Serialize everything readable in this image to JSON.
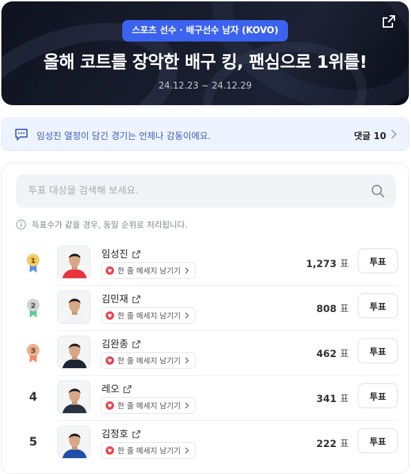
{
  "banner": {
    "badge": "스포츠 선수 · 배구선수 남자 (KOVO)",
    "title": "올해 코트를 장악한 배구 킹, 팬심으로 1위를!",
    "date_range": "24.12.23 ~ 24.12.29",
    "share_icon": "share-icon"
  },
  "comment_bar": {
    "message": "임성진 열정이 담긴 경기는 언제나 감동이에요.",
    "count_label": "댓글 10"
  },
  "search": {
    "placeholder": "투표 대상을 검색해 보세요."
  },
  "notice": "득표수가 같을 경우, 동일 순위로 처리됩니다.",
  "ranking": [
    {
      "rank": "1",
      "medal": "gold",
      "name": "임성진",
      "message_label": "한 줄 메세지 남기기",
      "votes": "1,273",
      "unit": "표",
      "vote_label": "투표",
      "jersey": "#e8343e"
    },
    {
      "rank": "2",
      "medal": "silver",
      "name": "김민재",
      "message_label": "한 줄 메세지 남기기",
      "votes": "808",
      "unit": "표",
      "vote_label": "투표",
      "jersey": "#f2f2f5"
    },
    {
      "rank": "3",
      "medal": "bronze",
      "name": "김완종",
      "message_label": "한 줄 메세지 남기기",
      "votes": "462",
      "unit": "표",
      "vote_label": "투표",
      "jersey": "#1d2433"
    },
    {
      "rank": "4",
      "medal": "",
      "name": "레오",
      "message_label": "한 줄 메세지 남기기",
      "votes": "341",
      "unit": "표",
      "vote_label": "투표",
      "jersey": "#2a3142"
    },
    {
      "rank": "5",
      "medal": "",
      "name": "김정호",
      "message_label": "한 줄 메세지 남기기",
      "votes": "222",
      "unit": "표",
      "vote_label": "투표",
      "jersey": "#1f4fa8"
    }
  ],
  "colors": {
    "accent": "#3c62f0",
    "medal_gold": "#f2c14a",
    "medal_silver": "#c5cad3",
    "medal_bronze": "#e8a27c",
    "heart": "#ef3f4a"
  }
}
